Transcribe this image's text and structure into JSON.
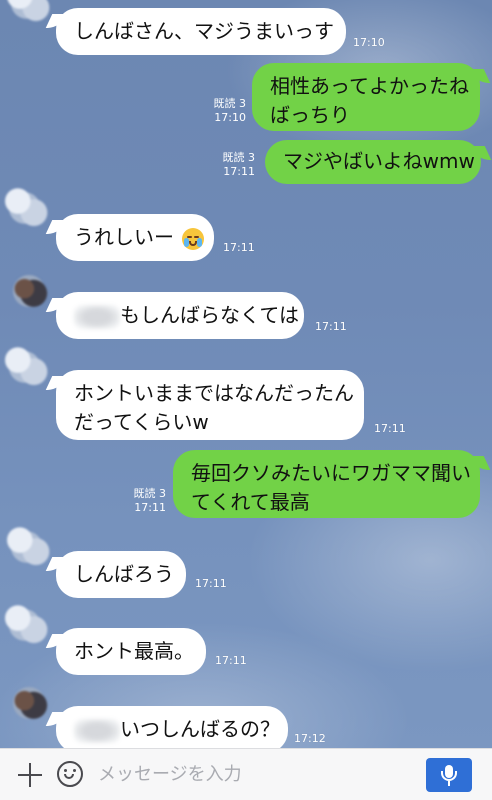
{
  "messages": [
    {
      "side": "in",
      "text": "しんばさん、マジうまいっす",
      "time": "17:10"
    },
    {
      "side": "out",
      "lines": [
        "相性あってよかったね",
        "ばっちり"
      ],
      "read": "既読 3",
      "time": "17:10"
    },
    {
      "side": "out",
      "text": "マジやばいよねwmw",
      "read": "既読 3",
      "time": "17:11"
    },
    {
      "side": "in",
      "text": "うれしいー",
      "emoji": "crying-face-icon",
      "time": "17:11"
    },
    {
      "side": "in",
      "text": "もしんばらなくては",
      "time": "17:11"
    },
    {
      "side": "in",
      "lines": [
        "ホントいままではなんだったん",
        "だってくらいw"
      ],
      "time": "17:11"
    },
    {
      "side": "out",
      "lines": [
        "毎回クソみたいにワガママ聞い",
        "てくれて最高"
      ],
      "read": "既読 3",
      "time": "17:11"
    },
    {
      "side": "in",
      "text": "しんばろう",
      "time": "17:11"
    },
    {
      "side": "in",
      "text": "ホント最高。",
      "time": "17:11"
    },
    {
      "side": "in",
      "text": "いつしんばるの？",
      "time": "17:12"
    }
  ],
  "input_bar": {
    "placeholder": "メッセージを入力",
    "plus_icon": "plus-icon",
    "emoji_icon": "smile-icon",
    "mic_icon": "microphone-icon"
  },
  "colors": {
    "background": "#6f8db9",
    "bubble_in": "#ffffff",
    "bubble_out": "#72d247",
    "mic_button": "#2f6fd6"
  }
}
